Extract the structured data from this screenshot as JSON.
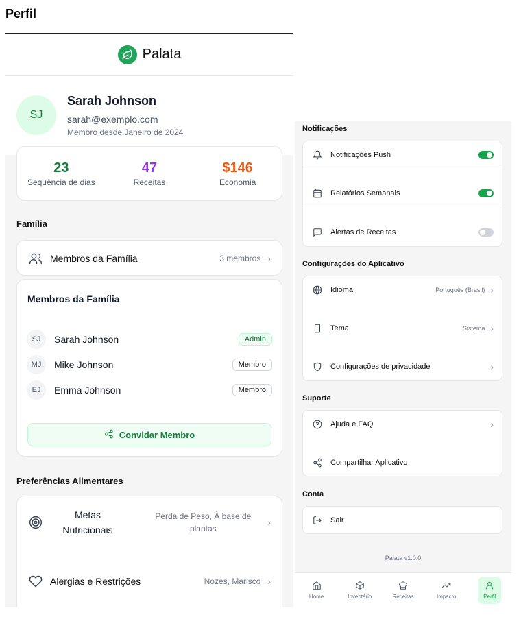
{
  "page_title": "Perfil",
  "app": {
    "name": "Palata",
    "version": "Palata v1.0.0"
  },
  "profile": {
    "initials": "SJ",
    "name": "Sarah Johnson",
    "email": "sarah@exemplo.com",
    "member_since": "Membro desde Janeiro de 2024"
  },
  "stats": [
    {
      "value": "23",
      "label": "Sequência de dias",
      "color": "#15803d"
    },
    {
      "value": "47",
      "label": "Receitas",
      "color": "#9333ea"
    },
    {
      "value": "$146",
      "label": "Economia",
      "color": "#ea580c"
    }
  ],
  "family": {
    "heading": "Família",
    "row_label": "Membros da Família",
    "row_value": "3 membros",
    "card_title": "Membros da Família",
    "members": [
      {
        "initials": "SJ",
        "name": "Sarah Johnson",
        "role": "Admin"
      },
      {
        "initials": "MJ",
        "name": "Mike Johnson",
        "role": "Membro"
      },
      {
        "initials": "EJ",
        "name": "Emma Johnson",
        "role": "Membro"
      }
    ],
    "invite_label": "Convidar Membro"
  },
  "food_prefs": {
    "heading": "Preferências Alimentares",
    "goals_label_1": "Metas",
    "goals_label_2": "Nutricionais",
    "goals_value_1": "Perda de Peso, À base de",
    "goals_value_2": "plantas",
    "allergies_label": "Alergias e Restrições",
    "allergies_value": "Nozes, Marisco"
  },
  "notifications": {
    "heading": "Notificações",
    "items": [
      {
        "label": "Notificações Push",
        "on": true
      },
      {
        "label": "Relatórios Semanais",
        "on": true
      },
      {
        "label": "Alertas de Receitas",
        "on": false
      }
    ]
  },
  "app_settings": {
    "heading": "Configurações do Aplicativo",
    "language_label": "Idioma",
    "language_value": "Português (Brasil)",
    "theme_label": "Tema",
    "theme_value": "Sistema",
    "privacy_label": "Configurações de privacidade"
  },
  "support": {
    "heading": "Suporte",
    "help_label": "Ajuda e FAQ",
    "share_label": "Compartilhar Aplicativo"
  },
  "account": {
    "heading": "Conta",
    "logout_label": "Sair"
  },
  "tabs": [
    {
      "label": "Home",
      "icon": "home-icon"
    },
    {
      "label": "Inventário",
      "icon": "box-icon"
    },
    {
      "label": "Receitas",
      "icon": "chef-hat-icon"
    },
    {
      "label": "Impacto",
      "icon": "trending-up-icon"
    },
    {
      "label": "Perfil",
      "icon": "user-icon",
      "active": true
    }
  ],
  "colors": {
    "accent": "#16a34a"
  }
}
